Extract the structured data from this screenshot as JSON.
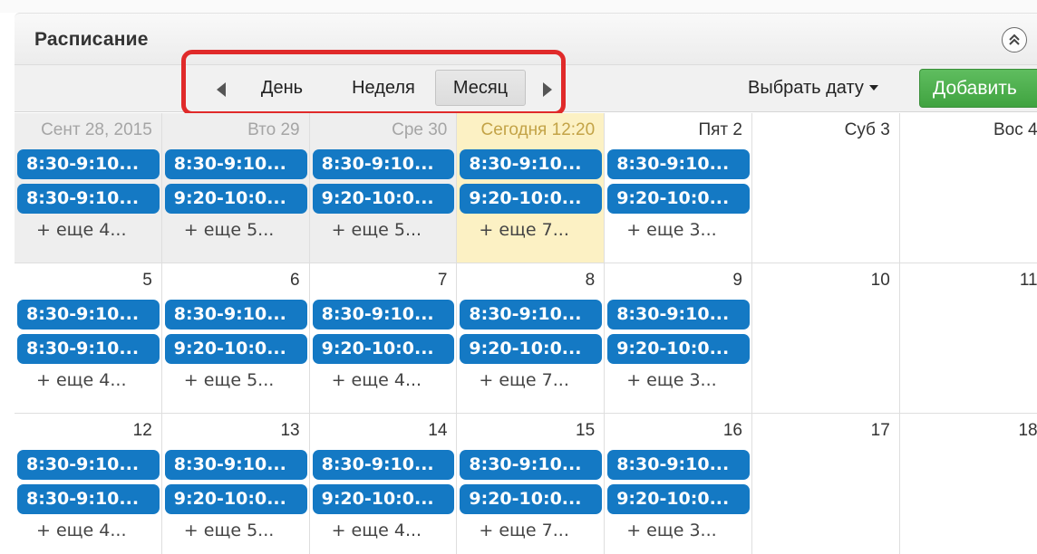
{
  "header": {
    "title": "Расписание"
  },
  "toolbar": {
    "views": [
      "День",
      "Неделя",
      "Месяц"
    ],
    "active_view": "Месяц",
    "date_picker_label": "Выбрать дату",
    "add_label": "Добавить"
  },
  "colors": {
    "event": "#1479c4",
    "today": "#fcf1c4",
    "past": "#eeeeee",
    "add_button": "#4cae4c",
    "highlight": "#e02a2a"
  },
  "calendar": {
    "weeks": [
      {
        "days": [
          {
            "label": "Сент 28, 2015",
            "state": "past",
            "events": [
              "8:30-9:10...",
              "8:30-9:10..."
            ],
            "more": "+ еще 4..."
          },
          {
            "label": "Вто 29",
            "state": "past",
            "events": [
              "8:30-9:10...",
              "9:20-10:0..."
            ],
            "more": "+ еще 5..."
          },
          {
            "label": "Сре 30",
            "state": "past",
            "events": [
              "8:30-9:10...",
              "9:20-10:0..."
            ],
            "more": "+ еще 5..."
          },
          {
            "label": "Сегодня 12:20",
            "state": "today",
            "events": [
              "8:30-9:10...",
              "9:20-10:0..."
            ],
            "more": "+ еще 7..."
          },
          {
            "label": "Пят 2",
            "state": "future",
            "events": [
              "8:30-9:10...",
              "9:20-10:0..."
            ],
            "more": "+ еще 3..."
          },
          {
            "label": "Суб 3",
            "state": "future",
            "events": [],
            "more": ""
          },
          {
            "label": "Вос 4",
            "state": "future",
            "events": [],
            "more": ""
          }
        ]
      },
      {
        "days": [
          {
            "label": "5",
            "state": "future",
            "events": [
              "8:30-9:10...",
              "8:30-9:10..."
            ],
            "more": "+ еще 4..."
          },
          {
            "label": "6",
            "state": "future",
            "events": [
              "8:30-9:10...",
              "9:20-10:0..."
            ],
            "more": "+ еще 5..."
          },
          {
            "label": "7",
            "state": "future",
            "events": [
              "8:30-9:10...",
              "9:20-10:0..."
            ],
            "more": "+ еще 4..."
          },
          {
            "label": "8",
            "state": "future",
            "events": [
              "8:30-9:10...",
              "9:20-10:0..."
            ],
            "more": "+ еще 7..."
          },
          {
            "label": "9",
            "state": "future",
            "events": [
              "8:30-9:10...",
              "9:20-10:0..."
            ],
            "more": "+ еще 3..."
          },
          {
            "label": "10",
            "state": "future",
            "events": [],
            "more": ""
          },
          {
            "label": "11",
            "state": "future",
            "events": [],
            "more": ""
          }
        ]
      },
      {
        "days": [
          {
            "label": "12",
            "state": "future",
            "events": [
              "8:30-9:10...",
              "8:30-9:10..."
            ],
            "more": "+ еще 4..."
          },
          {
            "label": "13",
            "state": "future",
            "events": [
              "8:30-9:10...",
              "9:20-10:0..."
            ],
            "more": "+ еще 5..."
          },
          {
            "label": "14",
            "state": "future",
            "events": [
              "8:30-9:10...",
              "9:20-10:0..."
            ],
            "more": "+ еще 4..."
          },
          {
            "label": "15",
            "state": "future",
            "events": [
              "8:30-9:10...",
              "9:20-10:0..."
            ],
            "more": "+ еще 7..."
          },
          {
            "label": "16",
            "state": "future",
            "events": [
              "8:30-9:10...",
              "9:20-10:0..."
            ],
            "more": "+ еще 3..."
          },
          {
            "label": "17",
            "state": "future",
            "events": [],
            "more": ""
          },
          {
            "label": "18",
            "state": "future",
            "events": [],
            "more": ""
          }
        ]
      }
    ]
  }
}
